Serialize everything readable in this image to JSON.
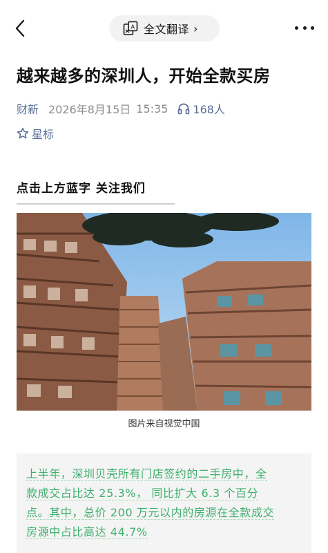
{
  "header": {
    "translate_label": "全文翻译",
    "translate_chevron": "›"
  },
  "article": {
    "title": "越来越多的深圳人，开始全款买房",
    "account": "财新",
    "date": "2026年8月15日",
    "time": "15:35",
    "listen_count": "168人",
    "star_label": "星标",
    "follow_text": "点击上方蓝字  关注我们",
    "image_caption": "图片来自视觉中国",
    "quote_lines": [
      "上半年，深圳贝壳所有门店签约的二手房中，全",
      "款成交占比达 25.3%，  同比扩大  6.3 个百分",
      "点。其中，总价 200 万元以内的房源在全款成交",
      "房源中占比高达 44.7%"
    ]
  },
  "colors": {
    "link_blue": "#576b95",
    "quote_green": "#3fae6e",
    "quote_bg": "#f3f4f3"
  },
  "icons": [
    "back-icon",
    "translate-icon",
    "more-icon",
    "headphone-icon",
    "star-icon"
  ]
}
